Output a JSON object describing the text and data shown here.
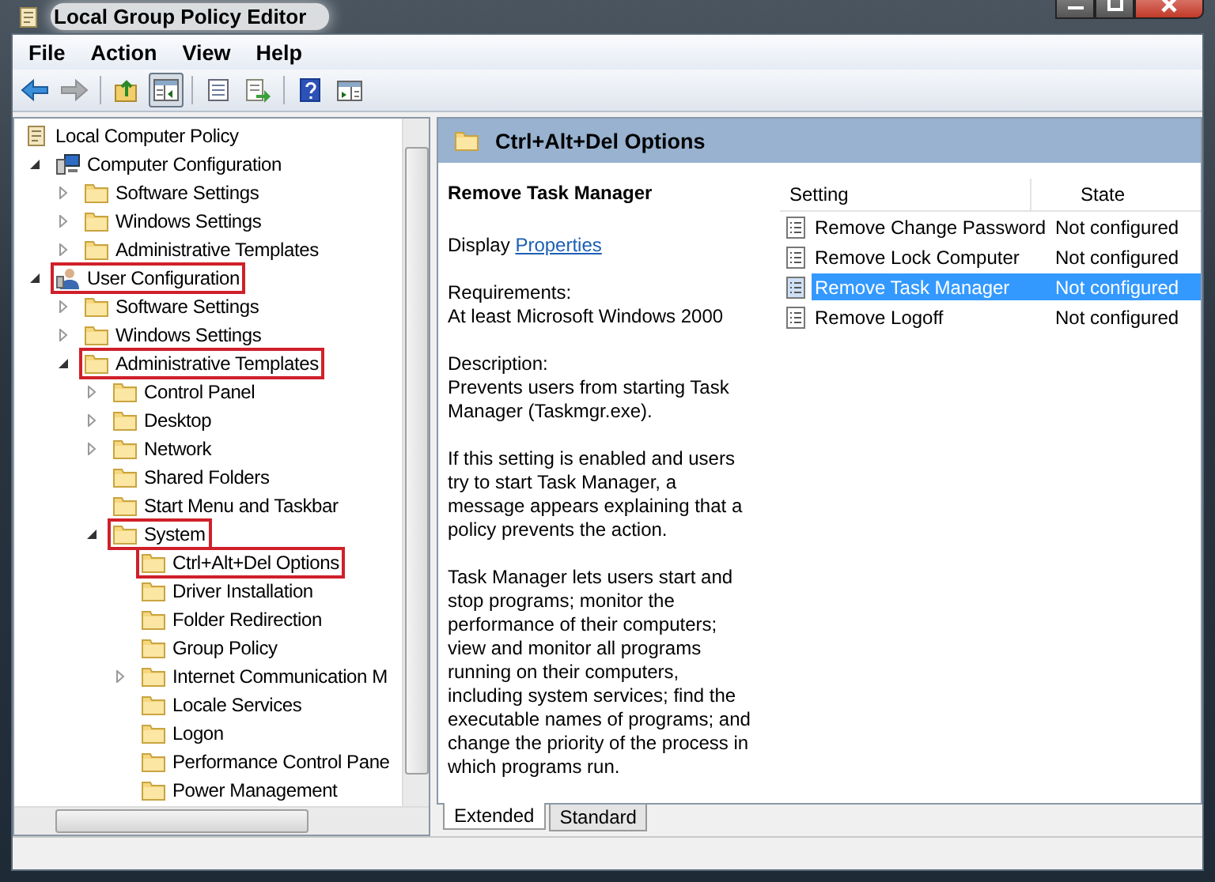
{
  "window": {
    "title": "Local Group Policy Editor"
  },
  "menu": [
    "File",
    "Action",
    "View",
    "Help"
  ],
  "toolbar": [
    {
      "kind": "back",
      "disabled": false,
      "pressed": false
    },
    {
      "kind": "forward",
      "disabled": true,
      "pressed": false
    },
    {
      "kind": "up",
      "disabled": false,
      "pressed": false
    },
    {
      "kind": "tree",
      "disabled": false,
      "pressed": true
    },
    {
      "kind": "properties",
      "disabled": false,
      "pressed": false
    },
    {
      "kind": "export",
      "disabled": false,
      "pressed": false
    },
    {
      "kind": "help",
      "disabled": false,
      "pressed": false
    },
    {
      "kind": "pane",
      "disabled": false,
      "pressed": false
    }
  ],
  "tree": [
    {
      "label": "Local Computer Policy",
      "kind": "policy",
      "marked": false,
      "children": [
        {
          "label": "Computer Configuration",
          "kind": "computer",
          "expanded": true,
          "marked": false,
          "children": [
            {
              "label": "Software Settings",
              "kind": "folder",
              "expanded": false,
              "marked": false
            },
            {
              "label": "Windows Settings",
              "kind": "folder",
              "expanded": false,
              "marked": false
            },
            {
              "label": "Administrative Templates",
              "kind": "folder",
              "expanded": false,
              "marked": false
            }
          ]
        },
        {
          "label": "User Configuration",
          "kind": "user",
          "expanded": true,
          "marked": true,
          "children": [
            {
              "label": "Software Settings",
              "kind": "folder",
              "expanded": false,
              "marked": false
            },
            {
              "label": "Windows Settings",
              "kind": "folder",
              "expanded": false,
              "marked": false
            },
            {
              "label": "Administrative Templates",
              "kind": "folder",
              "expanded": true,
              "marked": true,
              "children": [
                {
                  "label": "Control Panel",
                  "kind": "folder",
                  "expanded": false,
                  "marked": false
                },
                {
                  "label": "Desktop",
                  "kind": "folder",
                  "expanded": false,
                  "marked": false
                },
                {
                  "label": "Network",
                  "kind": "folder",
                  "expanded": false,
                  "marked": false
                },
                {
                  "label": "Shared Folders",
                  "kind": "folder",
                  "marked": false
                },
                {
                  "label": "Start Menu and Taskbar",
                  "kind": "folder",
                  "marked": false
                },
                {
                  "label": "System",
                  "kind": "folder",
                  "expanded": true,
                  "marked": true,
                  "children": [
                    {
                      "label": "Ctrl+Alt+Del Options",
                      "kind": "folder",
                      "marked": true
                    },
                    {
                      "label": "Driver Installation",
                      "kind": "folder",
                      "marked": false
                    },
                    {
                      "label": "Folder Redirection",
                      "kind": "folder",
                      "marked": false
                    },
                    {
                      "label": "Group Policy",
                      "kind": "folder",
                      "marked": false
                    },
                    {
                      "label": "Internet Communication M",
                      "kind": "folder",
                      "expanded": false,
                      "marked": false
                    },
                    {
                      "label": "Locale Services",
                      "kind": "folder",
                      "marked": false
                    },
                    {
                      "label": "Logon",
                      "kind": "folder",
                      "marked": false
                    },
                    {
                      "label": "Performance Control Pane",
                      "kind": "folder",
                      "marked": false
                    },
                    {
                      "label": "Power Management",
                      "kind": "folder",
                      "marked": false
                    }
                  ]
                }
              ]
            }
          ]
        }
      ]
    }
  ],
  "header": {
    "title": "Ctrl+Alt+Del Options"
  },
  "description": {
    "title": "Remove Task Manager",
    "display_prefix": "Display",
    "display_link": "Properties",
    "requirements_label": "Requirements:",
    "requirements": "At least Microsoft Windows 2000",
    "description_label": "Description:",
    "paragraphs": [
      "Prevents users from starting Task Manager (Taskmgr.exe).",
      "If this setting is enabled and users try to start Task Manager, a message appears explaining that a policy prevents the action.",
      "Task Manager lets users start and stop programs; monitor the performance of their computers; view and monitor all programs running on their computers, including system services; find the executable names of programs; and change the priority of the process in which programs run."
    ]
  },
  "table": {
    "columns": [
      "Setting",
      "State"
    ],
    "rows": [
      {
        "setting": "Remove Change Password",
        "state": "Not configured",
        "selected": false
      },
      {
        "setting": "Remove Lock Computer",
        "state": "Not configured",
        "selected": false
      },
      {
        "setting": "Remove Task Manager",
        "state": "Not configured",
        "selected": true
      },
      {
        "setting": "Remove Logoff",
        "state": "Not configured",
        "selected": false
      }
    ]
  },
  "tabs": [
    {
      "label": "Extended",
      "selected": true
    },
    {
      "label": "Standard",
      "selected": false
    }
  ]
}
